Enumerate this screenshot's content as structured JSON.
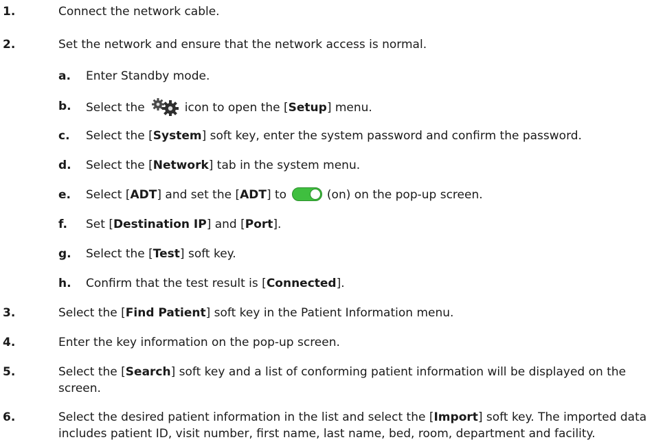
{
  "steps": [
    {
      "num": "1.",
      "text": "Connect the network cable."
    },
    {
      "num": "2.",
      "text": "Set the network and ensure that the network access is normal."
    },
    {
      "num": "3.",
      "pre": "Select the [",
      "bold": "Find Patient",
      "post": "] soft key in the Patient Information menu."
    },
    {
      "num": "4.",
      "text": "Enter the key information on the pop-up screen."
    },
    {
      "num": "5.",
      "pre": "Select the [",
      "bold": "Search",
      "post": "] soft key and a list of conforming patient information will be displayed on the screen."
    },
    {
      "num": "6.",
      "pre": "Select the desired patient information in the list and select the [",
      "bold": "Import",
      "post": "] soft key. The imported data includes patient ID, visit number, first name, last name, bed, room, department and facility."
    }
  ],
  "substeps": {
    "a": {
      "letter": "a.",
      "text": "Enter Standby mode."
    },
    "b": {
      "letter": "b.",
      "pre": "Select the",
      "post": "icon to open the [",
      "bold": "Setup",
      "post2": "] menu."
    },
    "c": {
      "letter": "c.",
      "pre": "Select the [",
      "bold": "System",
      "post": "] soft key, enter the system password and confirm the password."
    },
    "d": {
      "letter": "d.",
      "pre": "Select the [",
      "bold": "Network",
      "post": "] tab in the system menu."
    },
    "e": {
      "letter": "e.",
      "pre": "Select [",
      "bold1": "ADT",
      "mid": "] and set the [",
      "bold2": "ADT",
      "post": "] to",
      "post2": "(on) on the pop-up screen."
    },
    "f": {
      "letter": "f.",
      "pre": "Set [",
      "bold1": "Destination IP",
      "mid": "] and [",
      "bold2": "Port",
      "post": "]."
    },
    "g": {
      "letter": "g.",
      "pre": "Select the [",
      "bold": "Test",
      "post": "] soft key."
    },
    "h": {
      "letter": "h.",
      "pre": "Confirm that the test result is [",
      "bold": "Connected",
      "post": "]."
    }
  },
  "icons": {
    "setup": "gear-icon",
    "toggle_on": "toggle-on-icon"
  },
  "colors": {
    "toggle_on": "#3fbf3f",
    "text": "#1a1a1a"
  }
}
